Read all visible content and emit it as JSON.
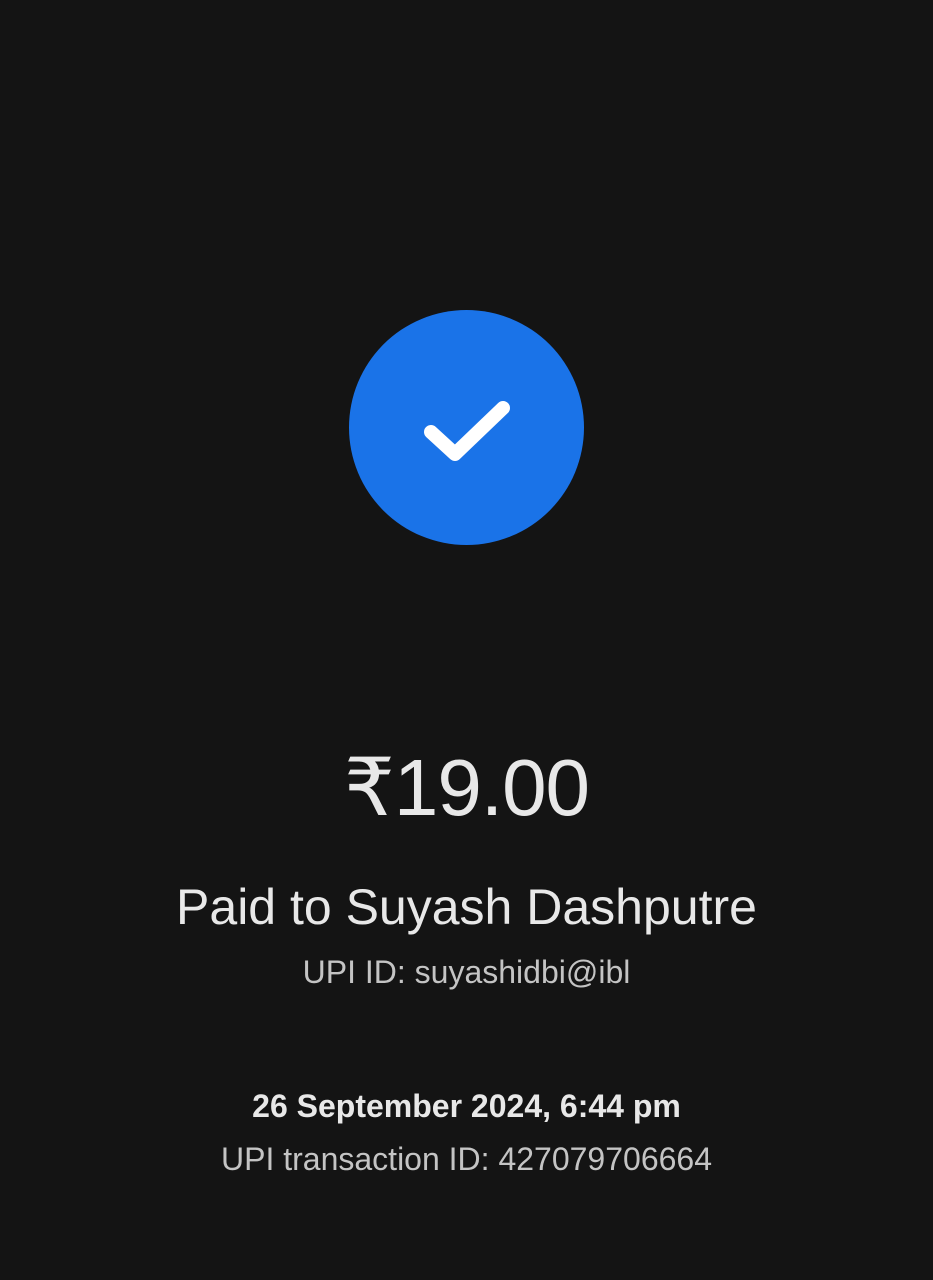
{
  "status": {
    "icon": "check-icon",
    "circle_color": "#1a73e8"
  },
  "payment": {
    "amount": "₹19.00",
    "paid_to": "Paid to Suyash Dashputre",
    "upi_id": "UPI ID: suyashidbi@ibl"
  },
  "transaction": {
    "datetime": "26 September 2024, 6:44 pm",
    "upi_transaction_id": "UPI transaction ID: 427079706664"
  }
}
